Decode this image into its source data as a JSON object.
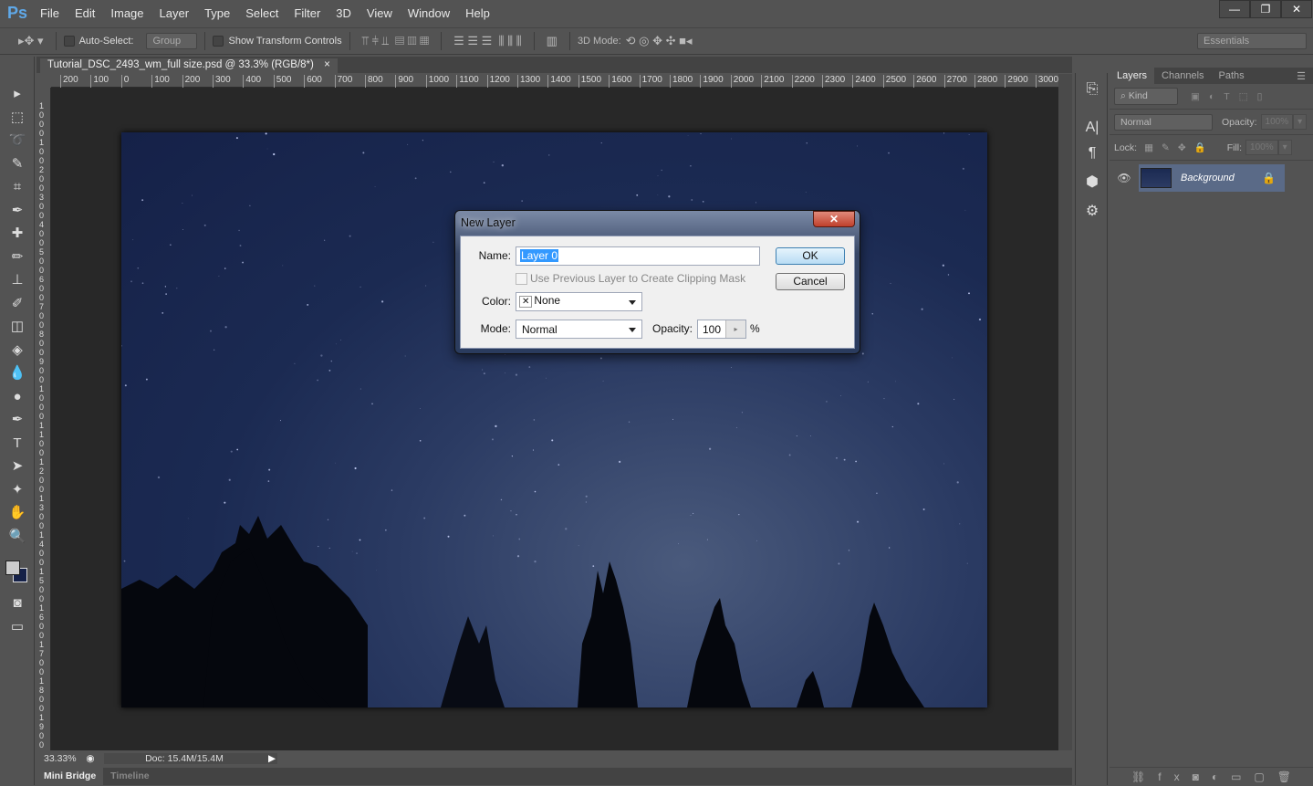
{
  "app": {
    "logo": "Ps",
    "menu": [
      "File",
      "Edit",
      "Image",
      "Layer",
      "Type",
      "Select",
      "Filter",
      "3D",
      "View",
      "Window",
      "Help"
    ],
    "window_buttons": [
      "—",
      "❐",
      "✕"
    ]
  },
  "options": {
    "auto_select_label": "Auto-Select:",
    "auto_select_value": "Group",
    "show_transform_label": "Show Transform Controls",
    "mode_3d_label": "3D Mode:",
    "workspace": "Essentials"
  },
  "document": {
    "tab_title": "Tutorial_DSC_2493_wm_full size.psd @ 33.3% (RGB/8*)",
    "close": "×",
    "zoom": "33.33%",
    "doc_size": "Doc: 15.4M/15.4M"
  },
  "ruler": {
    "top": [
      "200",
      "100",
      "0",
      "100",
      "200",
      "300",
      "400",
      "500",
      "600",
      "700",
      "800",
      "900",
      "1000",
      "1100",
      "1200",
      "1300",
      "1400",
      "1500",
      "1600",
      "1700",
      "1800",
      "1900",
      "2000",
      "2100",
      "2200",
      "2300",
      "2400",
      "2500",
      "2600",
      "2700",
      "2800",
      "2900",
      "3000"
    ],
    "left": [
      "1",
      "0",
      "0",
      "0",
      "1",
      "0",
      "0",
      "2",
      "0",
      "0",
      "3",
      "0",
      "0",
      "4",
      "0",
      "0",
      "5",
      "0",
      "0",
      "6",
      "0",
      "0",
      "7",
      "0",
      "0",
      "8",
      "0",
      "0",
      "9",
      "0",
      "0",
      "1",
      "0",
      "0",
      "0",
      "1",
      "1",
      "0",
      "0",
      "1",
      "2",
      "0",
      "0",
      "1",
      "3",
      "0",
      "0",
      "1",
      "4",
      "0",
      "0",
      "1",
      "5",
      "0",
      "0",
      "1",
      "6",
      "0",
      "0",
      "1",
      "7",
      "0",
      "0",
      "1",
      "8",
      "0",
      "0",
      "1",
      "9",
      "0",
      "0",
      "2"
    ]
  },
  "bottom_tabs": [
    "Mini Bridge",
    "Timeline"
  ],
  "layers_panel": {
    "tabs": [
      "Layers",
      "Channels",
      "Paths"
    ],
    "filter_kind": "Kind",
    "blend_mode": "Normal",
    "opacity_label": "Opacity:",
    "opacity_value": "100%",
    "lock_label": "Lock:",
    "fill_label": "Fill:",
    "fill_value": "100%",
    "layers": [
      {
        "name": "Background",
        "visible": true,
        "locked": true
      }
    ]
  },
  "dialog": {
    "title": "New Layer",
    "close": "✕",
    "name_label": "Name:",
    "name_value": "Layer 0",
    "clip_label": "Use Previous Layer to Create Clipping Mask",
    "clip_checked": false,
    "color_label": "Color:",
    "color_value": "None",
    "mode_label": "Mode:",
    "mode_value": "Normal",
    "opacity_label": "Opacity:",
    "opacity_value": "100",
    "percent": "%",
    "ok": "OK",
    "cancel": "Cancel"
  },
  "colors": {
    "accent_selection": "#3399ff",
    "ui_bg": "#535353",
    "canvas_bg": "#282828",
    "layer_selected": "#5a6a87"
  }
}
